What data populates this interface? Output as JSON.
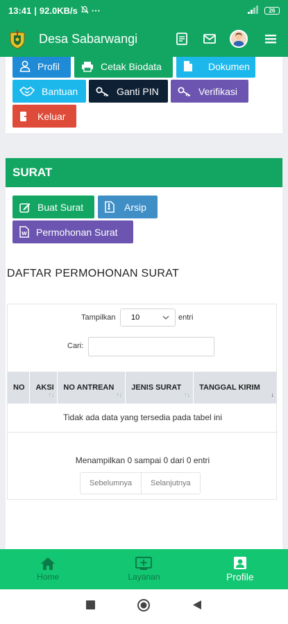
{
  "status_bar": {
    "time": "13:41",
    "speed": "92.0KB/s",
    "dots": "···",
    "battery": "26"
  },
  "app_bar": {
    "title": "Desa Sabarwangi",
    "icons": [
      "logo",
      "document-icon",
      "mail-icon",
      "avatar",
      "menu-icon"
    ]
  },
  "profile_buttons": [
    {
      "label": "Profil",
      "color": "#1f8ad6"
    },
    {
      "label": "Cetak Biodata",
      "color": "#13a663"
    },
    {
      "label": "Dokumen",
      "color": "#1cb8ec"
    },
    {
      "label": "Bantuan",
      "color": "#1cb8ec"
    },
    {
      "label": "Ganti PIN",
      "color": "#0e2033"
    },
    {
      "label": "Verifikasi",
      "color": "#6b55b0"
    },
    {
      "label": "Keluar",
      "color": "#df4b39"
    }
  ],
  "surat": {
    "title": "SURAT",
    "buttons": [
      {
        "label": "Buat Surat",
        "color": "#13a663"
      },
      {
        "label": "Arsip",
        "color": "#3f8fc6"
      },
      {
        "label": "Permohonan Surat",
        "color": "#6b55b0"
      }
    ],
    "list_title": "DAFTAR PERMOHONAN SURAT",
    "table": {
      "show_label": "Tampilkan",
      "show_value": "10",
      "show_suffix": "entri",
      "search_label": "Cari:",
      "search_value": "",
      "columns": [
        "NO",
        "AKSI",
        "NO ANTREAN",
        "JENIS SURAT",
        "TANGGAL KIRIM"
      ],
      "empty_text": "Tidak ada data yang tersedia pada tabel ini",
      "info": "Menampilkan 0 sampai 0 dari 0 entri",
      "prev": "Sebelumnya",
      "next": "Selanjutnya"
    }
  },
  "bottom_nav": [
    {
      "label": "Home",
      "active": false
    },
    {
      "label": "Layanan",
      "active": false
    },
    {
      "label": "Profile",
      "active": true
    }
  ]
}
